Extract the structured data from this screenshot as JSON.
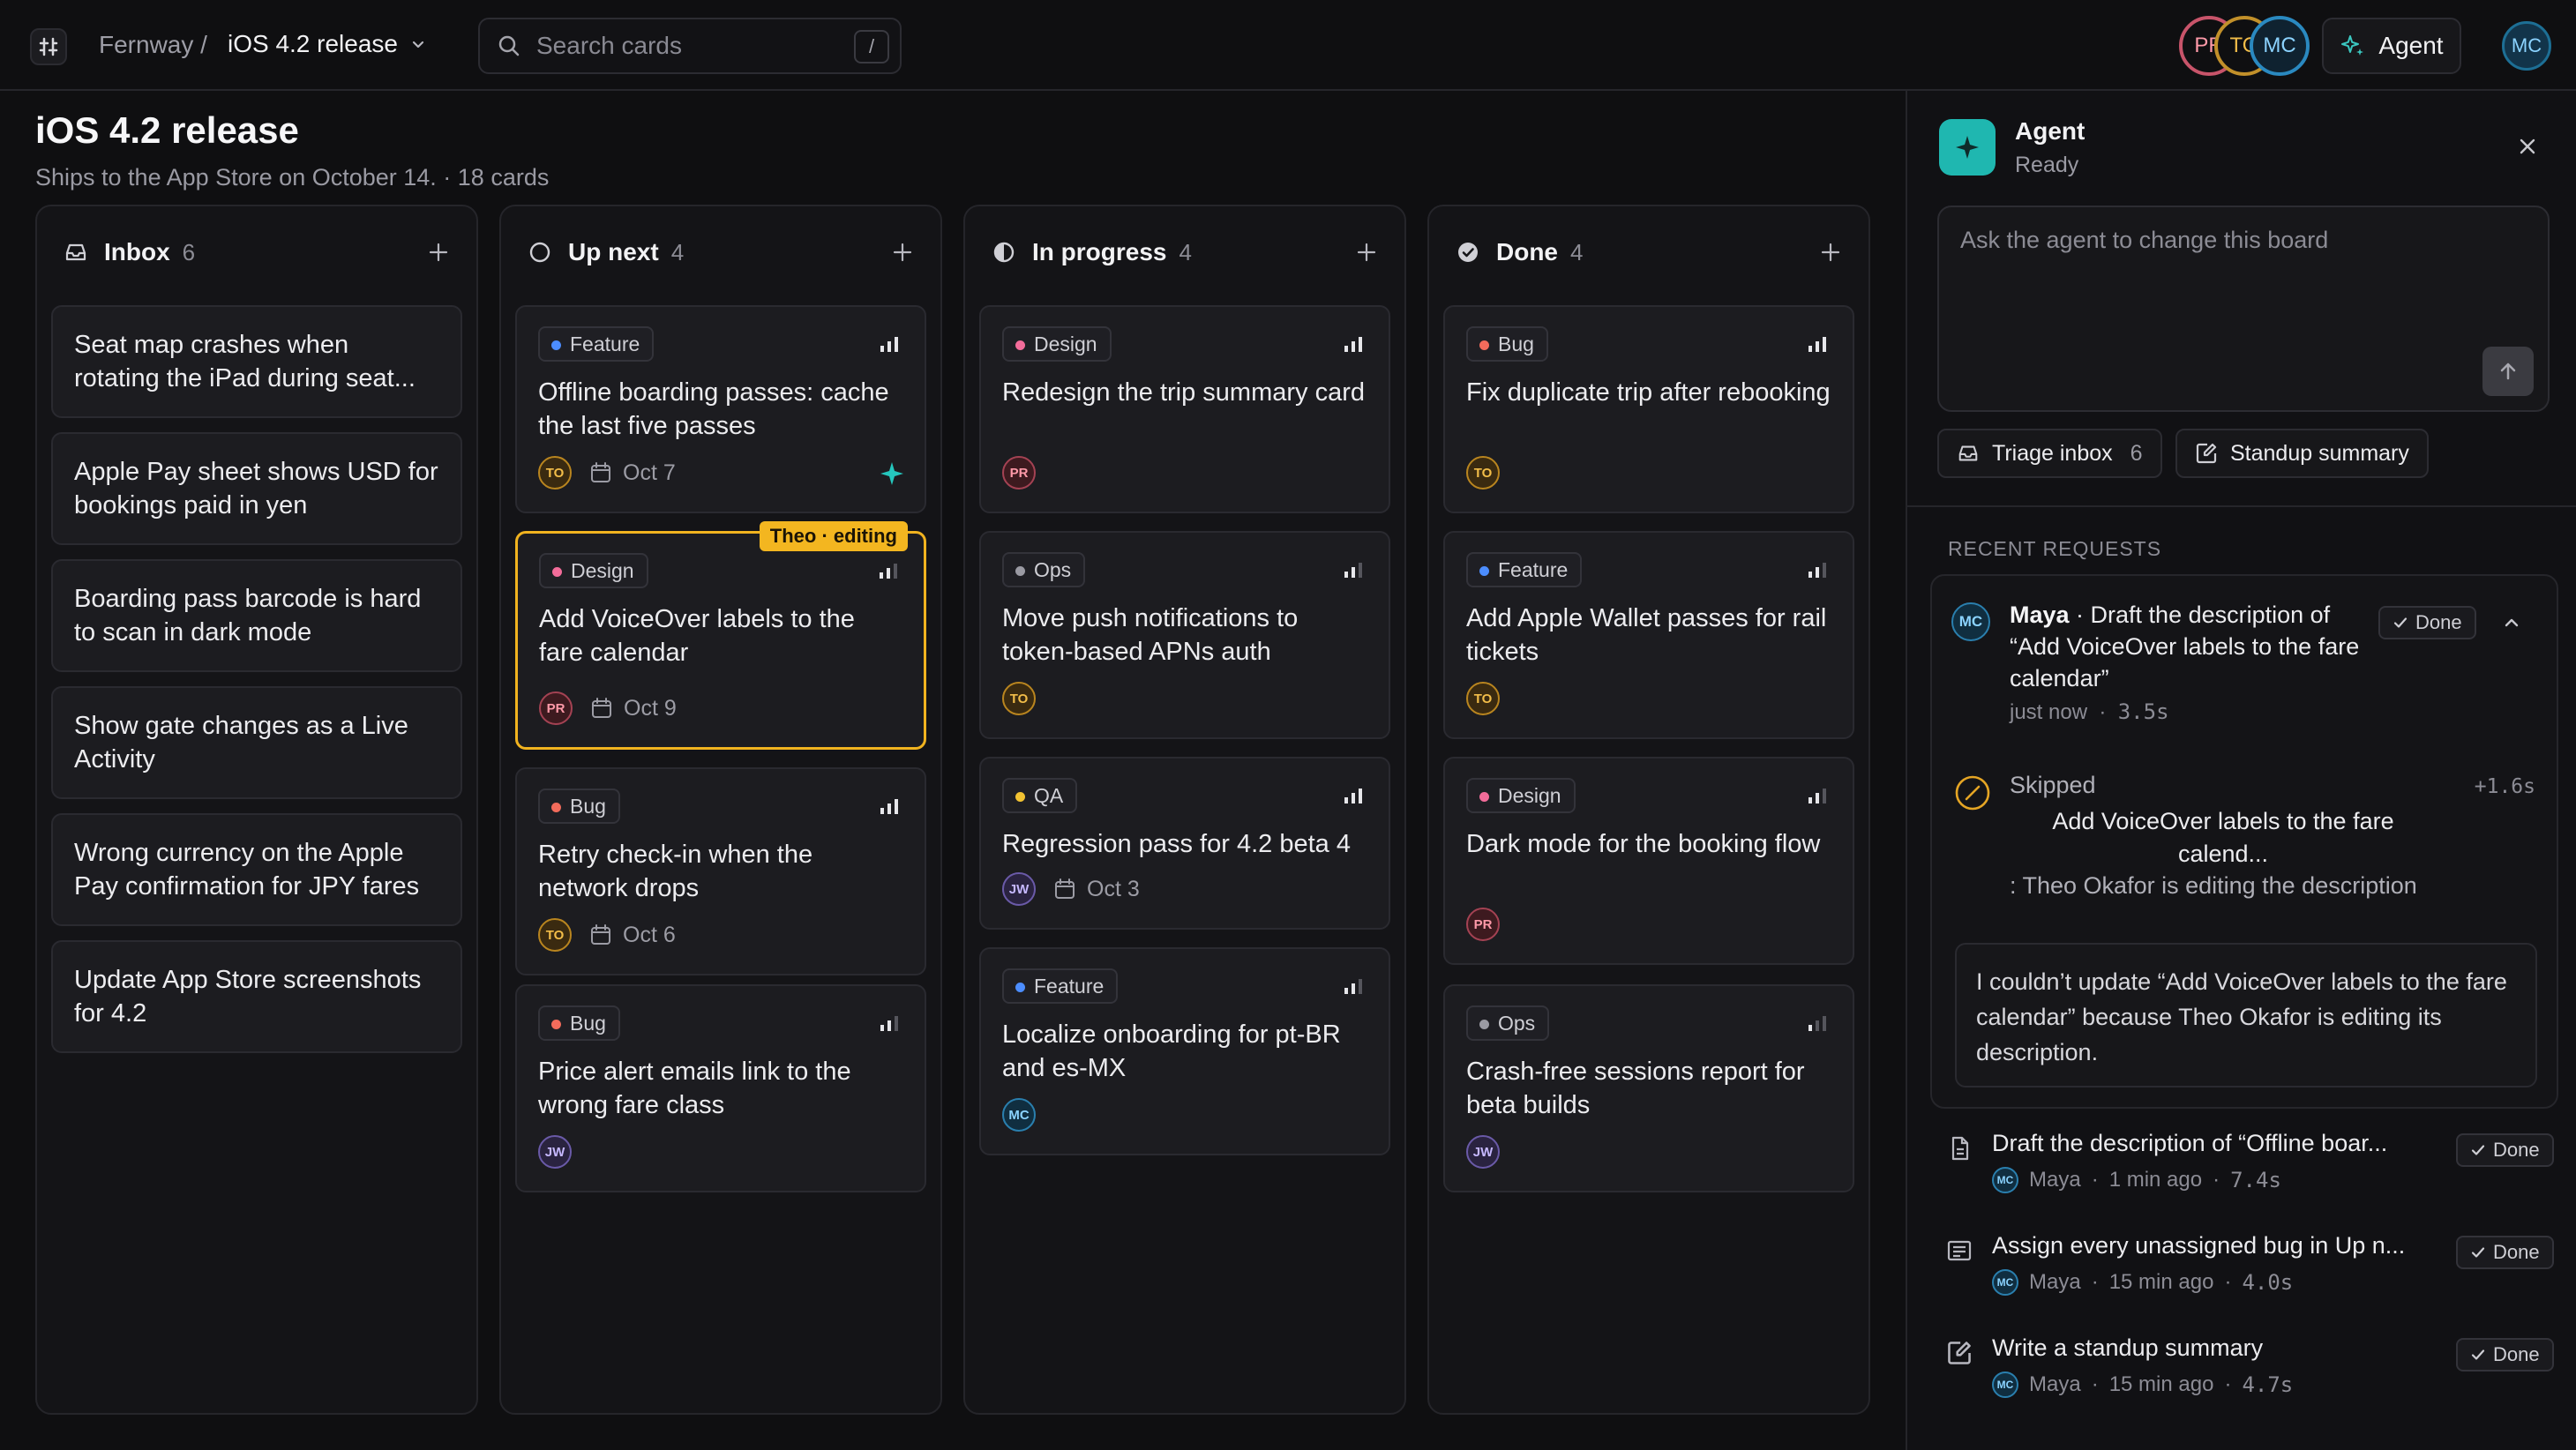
{
  "topbar": {
    "workspace": "Fernway /",
    "project": "iOS 4.2 release",
    "search_placeholder": "Search cards",
    "search_shortcut": "/",
    "presence": [
      "PR",
      "TO",
      "MC"
    ],
    "agent_button": "Agent",
    "user_initials": "MC"
  },
  "board": {
    "title": "iOS 4.2 release",
    "subtitle": "Ships to the App Store on October 14. · 18 cards",
    "columns": [
      {
        "title": "Inbox",
        "count": "6",
        "cards": [
          {
            "title": "Seat map crashes when rotating the iPad during seat..."
          },
          {
            "title": "Apple Pay sheet shows USD for bookings paid in yen"
          },
          {
            "title": "Boarding pass barcode is hard to scan in dark mode"
          },
          {
            "title": "Show gate changes as a Live Activity"
          },
          {
            "title": "Wrong currency on the Apple Pay confirmation for JPY fares"
          },
          {
            "title": "Update App Store screenshots for 4.2"
          }
        ]
      },
      {
        "title": "Up next",
        "count": "4",
        "cards": [
          {
            "tag": "Feature",
            "title": "Offline boarding passes: cache the last five passes",
            "assignee": "TO",
            "due": "Oct 7"
          },
          {
            "tag": "Design",
            "title": "Add VoiceOver labels to the fare calendar",
            "assignee": "PR",
            "due": "Oct 9",
            "editing": "Theo · editing"
          },
          {
            "tag": "Bug",
            "title": "Retry check-in when the network drops",
            "assignee": "TO",
            "due": "Oct 6"
          },
          {
            "tag": "Bug",
            "title": "Price alert emails link to the wrong fare class",
            "assignee": "JW"
          }
        ]
      },
      {
        "title": "In progress",
        "count": "4",
        "cards": [
          {
            "tag": "Design",
            "title": "Redesign the trip summary card",
            "assignee": "PR"
          },
          {
            "tag": "Ops",
            "title": "Move push notifications to token-based APNs auth",
            "assignee": "TO"
          },
          {
            "tag": "QA",
            "title": "Regression pass for 4.2 beta 4",
            "assignee": "JW",
            "due": "Oct 3"
          },
          {
            "tag": "Feature",
            "title": "Localize onboarding for pt-BR and es-MX",
            "assignee": "MC"
          }
        ]
      },
      {
        "title": "Done",
        "count": "4",
        "cards": [
          {
            "tag": "Bug",
            "title": "Fix duplicate trip after rebooking",
            "assignee": "TO"
          },
          {
            "tag": "Feature",
            "title": "Add Apple Wallet passes for rail tickets",
            "assignee": "TO"
          },
          {
            "tag": "Design",
            "title": "Dark mode for the booking flow",
            "assignee": "PR"
          },
          {
            "tag": "Ops",
            "title": "Crash-free sessions report for beta builds",
            "assignee": "JW"
          }
        ]
      }
    ]
  },
  "tag_colors": {
    "Feature": "#4c8dff",
    "Design": "#f36c9a",
    "Bug": "#f26b5b",
    "Ops": "#9a9aa3",
    "QA": "#f2c232"
  },
  "agent": {
    "name": "Agent",
    "status": "Ready",
    "prompt_placeholder": "Ask the agent to change this board",
    "quick_actions": [
      {
        "label": "Triage inbox",
        "count": "6"
      },
      {
        "label": "Standup summary"
      }
    ],
    "recent_label": "RECENT REQUESTS",
    "current_request": {
      "user": "Maya",
      "user_initials": "MC",
      "text": " · Draft the description of “Add VoiceOver labels to the fare calendar”",
      "time": "just now",
      "duration": "3.5s",
      "status": "Done",
      "step_label": "Skipped",
      "step_time": "+1.6s",
      "step_title": "Add VoiceOver labels to the fare calend...",
      "step_reason": ": Theo Okafor is editing the description",
      "reply": "I couldn’t update “Add VoiceOver labels to the fare calendar” because Theo Okafor is editing its description."
    },
    "history": [
      {
        "title": "Draft the description of “Offline boar...",
        "user": "Maya",
        "initials": "MC",
        "time": "1 min ago",
        "duration": "7.4s",
        "status": "Done"
      },
      {
        "title": "Assign every unassigned bug in Up n...",
        "user": "Maya",
        "initials": "MC",
        "time": "15 min ago",
        "duration": "4.0s",
        "status": "Done"
      },
      {
        "title": "Write a standup summary",
        "user": "Maya",
        "initials": "MC",
        "time": "15 min ago",
        "duration": "4.7s",
        "status": "Done"
      }
    ]
  }
}
